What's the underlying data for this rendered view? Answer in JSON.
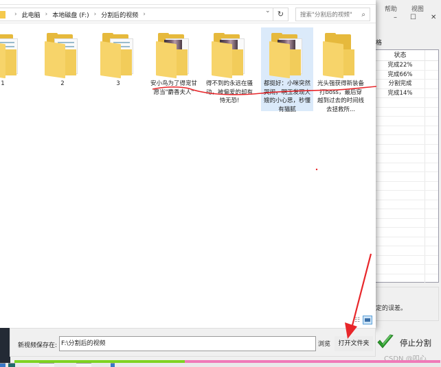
{
  "explorer": {
    "breadcrumb": [
      "此电脑",
      "本地磁盘 (F:)",
      "分割后的视频"
    ],
    "search_placeholder": "搜索\"分割后的视频\"",
    "refresh_icon": "refresh-icon",
    "items": [
      {
        "label": "1",
        "type": "folder-doc"
      },
      {
        "label": "2",
        "type": "folder-doc"
      },
      {
        "label": "3",
        "type": "folder-doc"
      },
      {
        "label": "安小鸟为了得宠甘愿当\"麝香夫人\"",
        "type": "folder-video"
      },
      {
        "label": "得不到的永远在骚动，被偏爱的却有恃无恐!",
        "type": "folder-video"
      },
      {
        "label": "都挺好：小咪突然哭闹，明玉发现大嫂的小心思，秒懂有猫腻",
        "type": "folder-video",
        "selected": true
      },
      {
        "label": "光头强获得新装备打boss，最后穿越到过去的时间线去拯救所...",
        "type": "folder-empty"
      }
    ]
  },
  "background_app": {
    "top_labels": [
      "帮助",
      "视图"
    ],
    "window_controls": {
      "minimize": "–",
      "maximize": "☐",
      "close": "✕"
    },
    "tab_label": "格",
    "status_header": "状态",
    "statuses": [
      "完成22%",
      "完成66%",
      "分割完成",
      "完成14%"
    ],
    "hint_text": "定的误差。"
  },
  "bottom": {
    "save_label": "新视频保存在:",
    "save_path": "F:\\分割后的视频",
    "browse_label": "浏览",
    "open_folder_label": "打开文件夹",
    "stop_label": "停止分割",
    "progress": 0.4,
    "watermark": "CSDN @叩心"
  },
  "colors": {
    "progress_done": "#7ed321",
    "progress_remaining": "#f07ab8",
    "annotation_red": "#e8262a",
    "selection": "#dbeafa"
  }
}
